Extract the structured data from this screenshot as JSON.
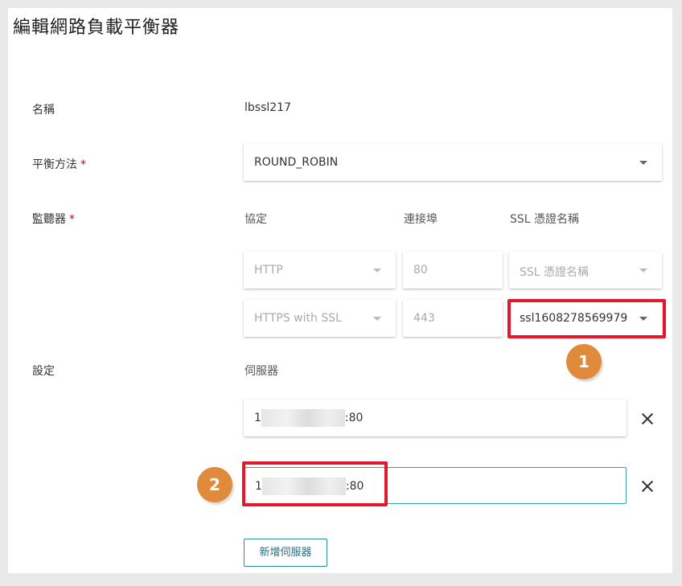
{
  "dialog": {
    "title": "編輯網路負載平衡器"
  },
  "form": {
    "name_label": "名稱",
    "name_value": "lbssl217",
    "balance_label": "平衡方法",
    "balance_required": "*",
    "balance_value": "ROUND_ROBIN",
    "listener_label": "監聽器",
    "listener_required": "*",
    "columns": {
      "protocol": "協定",
      "port": "連接埠",
      "ssl": "SSL 憑證名稱"
    },
    "listeners": [
      {
        "protocol": "HTTP",
        "port": "80",
        "ssl": "SSL 憑證名稱"
      },
      {
        "protocol": "HTTPS with SSL",
        "port": "443",
        "ssl": "ssl1608278569979"
      }
    ],
    "settings_label": "設定",
    "servers_header": "伺服器",
    "servers": [
      {
        "prefix": "1",
        "suffix": ":80"
      },
      {
        "prefix": "1",
        "suffix": ":80"
      }
    ],
    "add_server_label": "新增伺服器"
  },
  "annotations": {
    "badge1": "1",
    "badge2": "2",
    "highlight_color": "#e3182d",
    "badge_color": "#e08a3c"
  },
  "colors": {
    "accent": "#2a8ea0",
    "required": "#d0021b"
  }
}
